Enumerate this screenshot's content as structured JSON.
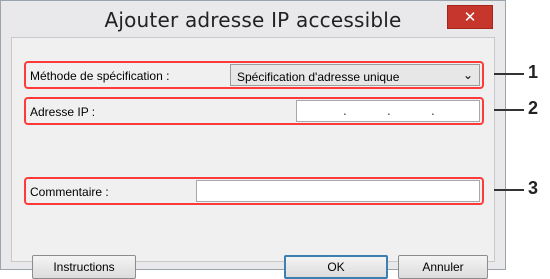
{
  "dialog": {
    "title": "Ajouter adresse IP accessible",
    "close_glyph": "✕"
  },
  "method": {
    "label": "Méthode de spécification :",
    "selected": "Spécification d'adresse unique",
    "chevron": "⌄"
  },
  "ip": {
    "label": "Adresse IP :",
    "separator": "."
  },
  "comment": {
    "label": "Commentaire :",
    "value": ""
  },
  "buttons": {
    "instructions": "Instructions",
    "ok": "OK",
    "cancel": "Annuler"
  },
  "callouts": [
    "1",
    "2",
    "3"
  ],
  "colors": {
    "highlight_border": "#ff3a3a",
    "close_button": "#c7362c"
  }
}
